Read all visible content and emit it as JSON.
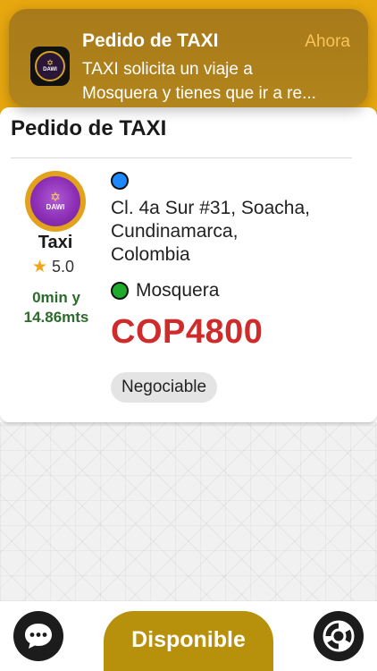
{
  "notification": {
    "title": "Pedido de TAXI",
    "time": "Ahora",
    "line1": "TAXI solicita un viaje a",
    "line2": "Mosquera y tienes que ir a re...",
    "icon": "dawi-logo-icon"
  },
  "order": {
    "title": "Pedido de TAXI",
    "vehicle": "Taxi",
    "rating": "5.0",
    "eta_line1": "0min y",
    "eta_line2": "14.86mts",
    "logo_text": "DAWI",
    "origin_lines": [
      "Cl. 4a Sur #31, Soacha,",
      "Cundinamarca,",
      "Colombia"
    ],
    "destination": "Mosquera",
    "price": "COP4800",
    "tag": "Negociable"
  },
  "bottom": {
    "status_button": "Disponible",
    "chat_icon": "chat-bubble-icon",
    "help_icon": "lifebuoy-icon"
  },
  "colors": {
    "accent": "#e7a70f",
    "notification_bg": "#ab7d1b",
    "price": "#cf2b2b",
    "eta": "#2d6b2c",
    "origin_dot": "#1e88ff",
    "destination_dot": "#1faa2c",
    "status_button": "#b7900c"
  }
}
